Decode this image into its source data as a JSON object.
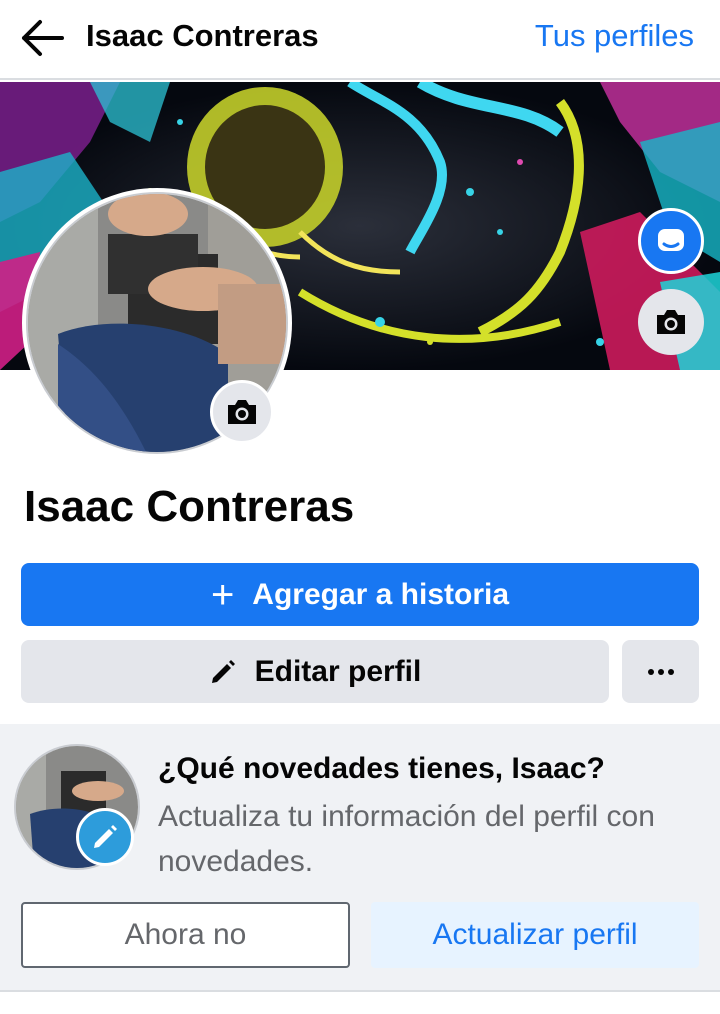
{
  "header": {
    "title": "Isaac Contreras",
    "profiles_link": "Tus perfiles",
    "back_icon": "arrow-left-icon"
  },
  "cover": {
    "avatar_frame_icon": "avatar-frame-icon",
    "camera_icon": "camera-icon"
  },
  "profile": {
    "name": "Isaac Contreras",
    "camera_icon": "camera-icon"
  },
  "actions": {
    "add_story_label": "Agregar a historia",
    "add_story_icon": "plus-icon",
    "edit_profile_label": "Editar perfil",
    "edit_profile_icon": "pencil-icon",
    "more_icon": "more-dots-icon"
  },
  "prompt": {
    "title": "¿Qué novedades tienes, Isaac?",
    "text": "Actualiza tu información del perfil con novedades.",
    "dismiss_label": "Ahora no",
    "update_label": "Actualizar perfil",
    "edit_icon": "pencil-icon"
  },
  "colors": {
    "accent": "#1877f2",
    "button_gray": "#e4e6eb",
    "secondary_text": "#65676b",
    "card_background": "#f0f2f5",
    "light_blue": "#e7f3ff"
  }
}
